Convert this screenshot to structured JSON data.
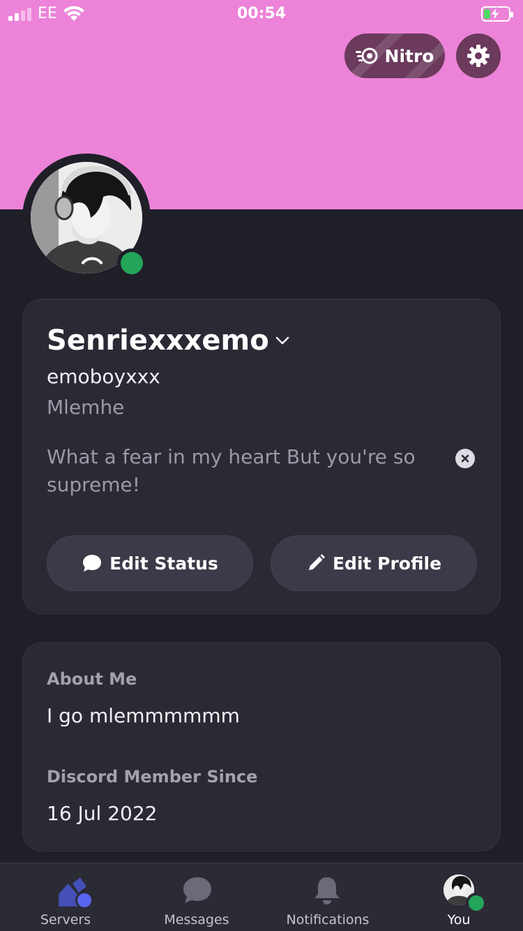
{
  "status_bar": {
    "carrier": "EE",
    "time": "00:54",
    "battery_level": 0.25,
    "charging": true
  },
  "header": {
    "nitro_label": "Nitro",
    "banner_color": "#ec83d8"
  },
  "profile": {
    "display_name": "Senriexxxemo",
    "username": "emoboyxxx",
    "pronouns": "Mlemhe",
    "custom_status": "What a fear in my heart But you're so supreme!",
    "presence": "online",
    "edit_status_label": "Edit Status",
    "edit_profile_label": "Edit Profile"
  },
  "about": {
    "about_me_label": "About Me",
    "about_me_text": "I go mlemmmmmm",
    "member_since_label": "Discord Member Since",
    "member_since_date": "16 Jul 2022"
  },
  "bottom_nav": {
    "items": [
      {
        "label": "Servers",
        "icon": "servers-icon"
      },
      {
        "label": "Messages",
        "icon": "chat-bubble-icon"
      },
      {
        "label": "Notifications",
        "icon": "bell-icon"
      },
      {
        "label": "You",
        "icon": "avatar",
        "active": true
      }
    ]
  },
  "colors": {
    "background": "#1f1f28",
    "card": "#2a2a35",
    "online": "#23a55a",
    "nitro_button": "#6b3a5c",
    "servers_accent": "#5865f2"
  }
}
